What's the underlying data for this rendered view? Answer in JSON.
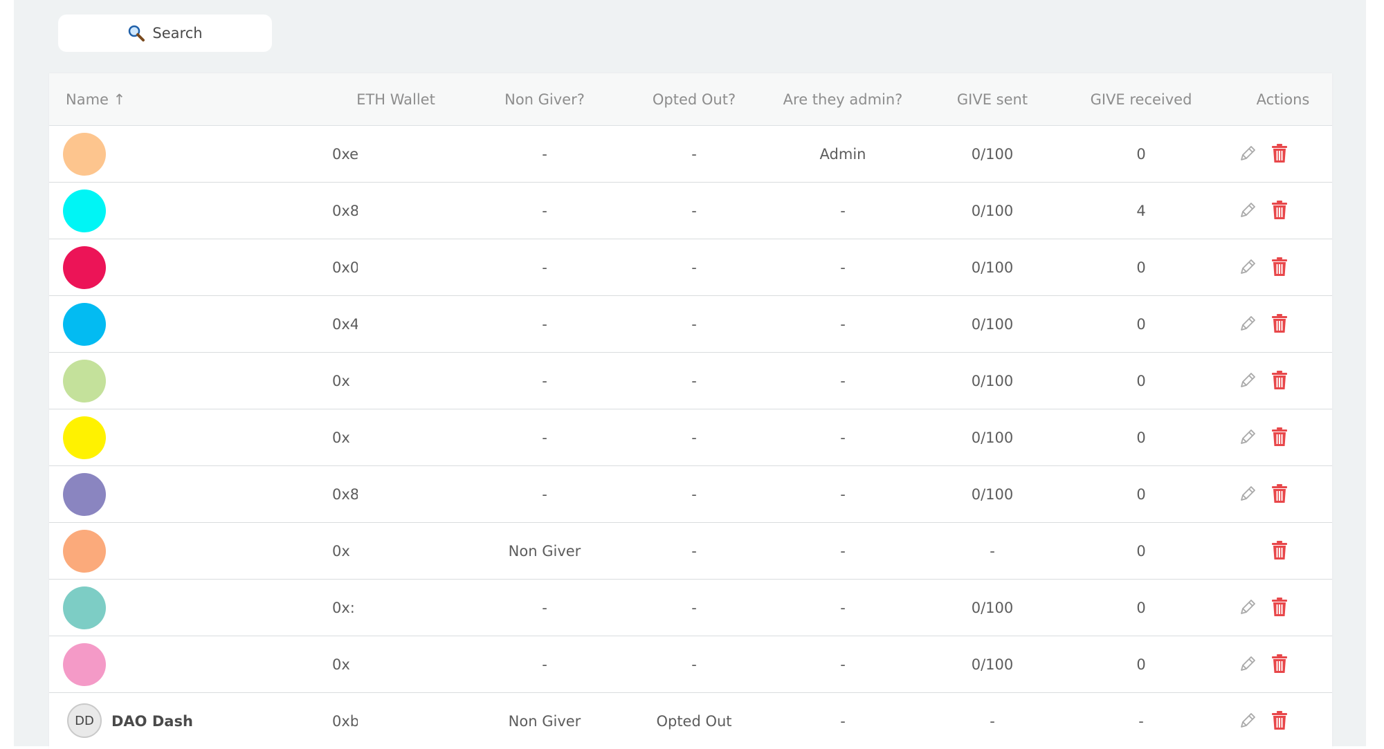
{
  "search": {
    "label": "Search",
    "icon": "magnifier-icon"
  },
  "table": {
    "columns": {
      "name": "Name ↑",
      "eth_wallet": "ETH Wallet",
      "non_giver": "Non Giver?",
      "opted_out": "Opted Out?",
      "admin": "Are they admin?",
      "give_sent": "GIVE sent",
      "give_received": "GIVE received",
      "actions": "Actions"
    },
    "rows": [
      {
        "avatar_color": "#fdc58e",
        "name": "",
        "wallet": "0xe",
        "non_giver": "-",
        "opted_out": "-",
        "admin": "Admin",
        "give_sent": "0/100",
        "give_received": "0",
        "editable": true
      },
      {
        "avatar_color": "#00f5f5",
        "name": "",
        "wallet": "0x8",
        "non_giver": "-",
        "opted_out": "-",
        "admin": "-",
        "give_sent": "0/100",
        "give_received": "4",
        "editable": true
      },
      {
        "avatar_color": "#ec1457",
        "name": "",
        "wallet": "0x0",
        "non_giver": "-",
        "opted_out": "-",
        "admin": "-",
        "give_sent": "0/100",
        "give_received": "0",
        "editable": true
      },
      {
        "avatar_color": "#03bbf2",
        "name": "",
        "wallet": "0x4",
        "non_giver": "-",
        "opted_out": "-",
        "admin": "-",
        "give_sent": "0/100",
        "give_received": "0",
        "editable": true
      },
      {
        "avatar_color": "#c4e19b",
        "name": "",
        "wallet": "0x",
        "non_giver": "-",
        "opted_out": "-",
        "admin": "-",
        "give_sent": "0/100",
        "give_received": "0",
        "editable": true
      },
      {
        "avatar_color": "#fff200",
        "name": "",
        "wallet": "0x",
        "non_giver": "-",
        "opted_out": "-",
        "admin": "-",
        "give_sent": "0/100",
        "give_received": "0",
        "editable": true
      },
      {
        "avatar_color": "#8a85c0",
        "name": "",
        "wallet": "0x8",
        "non_giver": "-",
        "opted_out": "-",
        "admin": "-",
        "give_sent": "0/100",
        "give_received": "0",
        "editable": true
      },
      {
        "avatar_color": "#fbaa7b",
        "name": "",
        "wallet": "0x",
        "non_giver": "Non Giver",
        "opted_out": "-",
        "admin": "-",
        "give_sent": "-",
        "give_received": "0",
        "editable": false
      },
      {
        "avatar_color": "#7dcdc5",
        "name": "",
        "wallet": "0x:",
        "non_giver": "-",
        "opted_out": "-",
        "admin": "-",
        "give_sent": "0/100",
        "give_received": "0",
        "editable": true
      },
      {
        "avatar_color": "#f49ac7",
        "name": "",
        "wallet": "0x",
        "non_giver": "-",
        "opted_out": "-",
        "admin": "-",
        "give_sent": "0/100",
        "give_received": "0",
        "editable": true
      },
      {
        "avatar_color": "",
        "initials": "DD",
        "name": "DAO Dash",
        "wallet": "0xb",
        "non_giver": "Non Giver",
        "opted_out": "Opted Out",
        "admin": "-",
        "give_sent": "-",
        "give_received": "-",
        "editable": true
      }
    ]
  },
  "colors": {
    "delete": "#e8474a",
    "edit": "#a9a9a9",
    "background": "#eff2f3"
  }
}
